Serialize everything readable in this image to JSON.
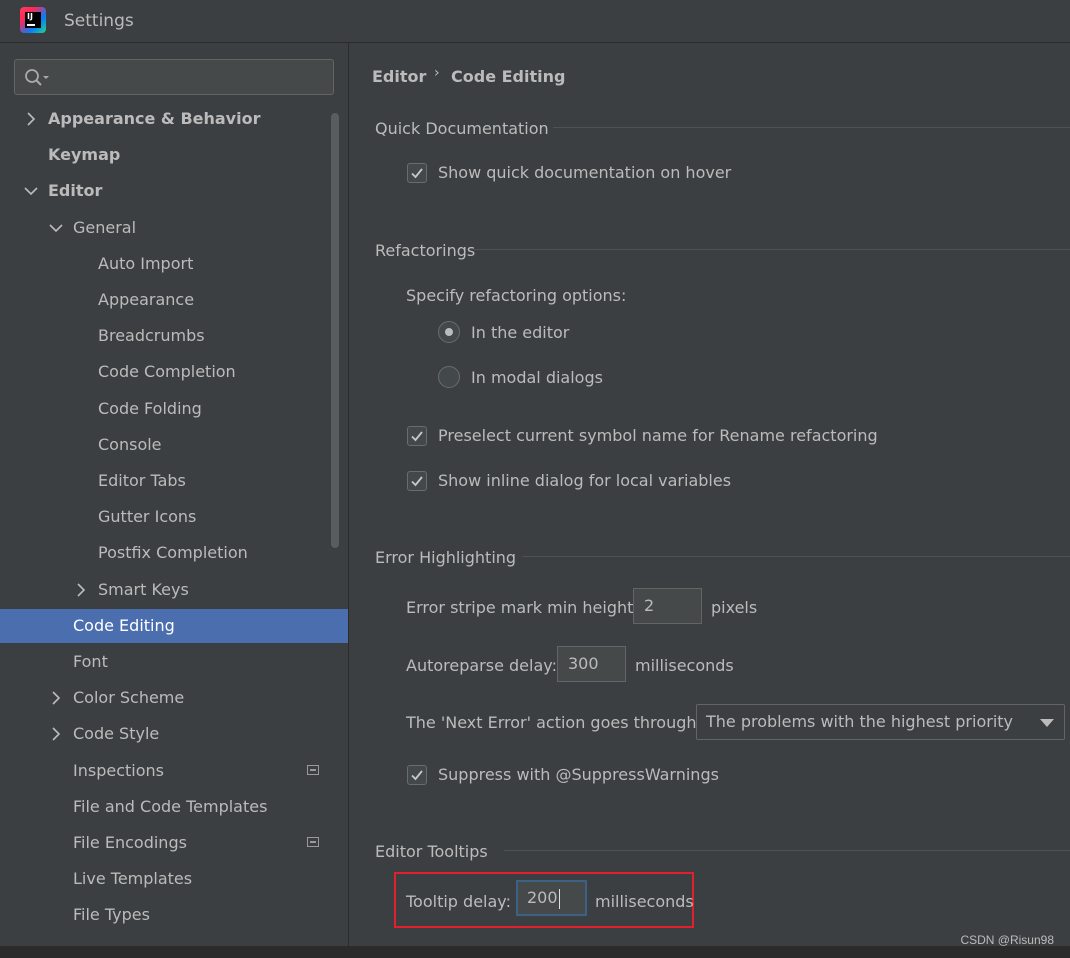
{
  "window": {
    "title": "Settings"
  },
  "search": {
    "placeholder": ""
  },
  "sidebar": {
    "items": [
      {
        "label": "Appearance & Behavior",
        "bold": true,
        "chevron": "right"
      },
      {
        "label": "Keymap",
        "bold": true,
        "chevron": "none"
      },
      {
        "label": "Editor",
        "bold": true,
        "chevron": "down"
      },
      {
        "label": "General",
        "bold": false,
        "chevron": "down"
      },
      {
        "label": "Auto Import",
        "bold": false,
        "chevron": "none"
      },
      {
        "label": "Appearance",
        "bold": false,
        "chevron": "none"
      },
      {
        "label": "Breadcrumbs",
        "bold": false,
        "chevron": "none"
      },
      {
        "label": "Code Completion",
        "bold": false,
        "chevron": "none"
      },
      {
        "label": "Code Folding",
        "bold": false,
        "chevron": "none"
      },
      {
        "label": "Console",
        "bold": false,
        "chevron": "none"
      },
      {
        "label": "Editor Tabs",
        "bold": false,
        "chevron": "none"
      },
      {
        "label": "Gutter Icons",
        "bold": false,
        "chevron": "none"
      },
      {
        "label": "Postfix Completion",
        "bold": false,
        "chevron": "none"
      },
      {
        "label": "Smart Keys",
        "bold": false,
        "chevron": "right"
      },
      {
        "label": "Code Editing",
        "bold": false,
        "chevron": "none",
        "selected": true
      },
      {
        "label": "Font",
        "bold": false,
        "chevron": "none"
      },
      {
        "label": "Color Scheme",
        "bold": false,
        "chevron": "right"
      },
      {
        "label": "Code Style",
        "bold": false,
        "chevron": "right"
      },
      {
        "label": "Inspections",
        "bold": false,
        "chevron": "none",
        "project_icon": true
      },
      {
        "label": "File and Code Templates",
        "bold": false,
        "chevron": "none"
      },
      {
        "label": "File Encodings",
        "bold": false,
        "chevron": "none",
        "project_icon": true
      },
      {
        "label": "Live Templates",
        "bold": false,
        "chevron": "none"
      },
      {
        "label": "File Types",
        "bold": false,
        "chevron": "none"
      }
    ]
  },
  "breadcrumb": {
    "parent": "Editor",
    "current": "Code Editing",
    "separator": "›"
  },
  "quick_doc": {
    "title": "Quick Documentation",
    "show_on_hover": {
      "label": "Show quick documentation on hover",
      "checked": true
    }
  },
  "refactorings": {
    "title": "Refactorings",
    "specify_label": "Specify refactoring options:",
    "in_editor": {
      "label": "In the editor",
      "selected": true
    },
    "modal_dialogs": {
      "label": "In modal dialogs",
      "selected": false
    },
    "preselect": {
      "label": "Preselect current symbol name for Rename refactoring",
      "checked": true
    },
    "inline_dialog": {
      "label": "Show inline dialog for local variables",
      "checked": true
    }
  },
  "error_highlighting": {
    "title": "Error Highlighting",
    "stripe_label": "Error stripe mark min height:",
    "stripe_value": "2",
    "stripe_unit": "pixels",
    "autoreparse_label": "Autoreparse delay:",
    "autoreparse_value": "300",
    "autoreparse_unit": "milliseconds",
    "next_error_label": "The 'Next Error' action goes through:",
    "next_error_value": "The problems with the highest priority",
    "suppress": {
      "label": "Suppress with @SuppressWarnings",
      "checked": true
    }
  },
  "editor_tooltips": {
    "title": "Editor Tooltips",
    "delay_label": "Tooltip delay:",
    "delay_value": "200",
    "delay_unit": "milliseconds"
  },
  "watermark": "CSDN @Risun98",
  "colors": {
    "background": "#3c3f41",
    "selection": "#4b6eaf",
    "text": "#bbbbbb",
    "highlight_box": "#e0202a",
    "focus_border": "#3d6185"
  }
}
